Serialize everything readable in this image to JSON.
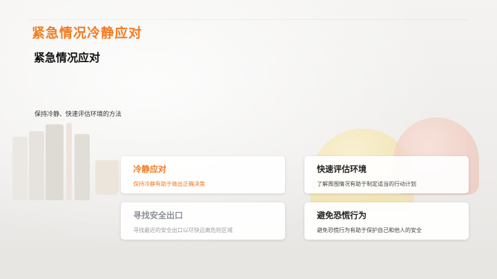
{
  "header": {
    "title": "紧急情况冷静应对",
    "subtitle": "紧急情况应对",
    "description": "保持冷静、快速评估环境的方法"
  },
  "cards": [
    {
      "title": "冷静应对",
      "text": "保持冷静有助于做出正确决策"
    },
    {
      "title": "快速评估环境",
      "text": "了解周围情况有助于制定适当的行动计划"
    },
    {
      "title": "寻找安全出口",
      "text": "寻找最近的安全出口以尽快远离危险区域"
    },
    {
      "title": "避免恐慌行为",
      "text": "避免恐慌行为有助于保护自己和他人的安全"
    }
  ],
  "colors": {
    "accent": "#f47a1f",
    "heading": "#111111",
    "muted": "#8c8f98"
  }
}
